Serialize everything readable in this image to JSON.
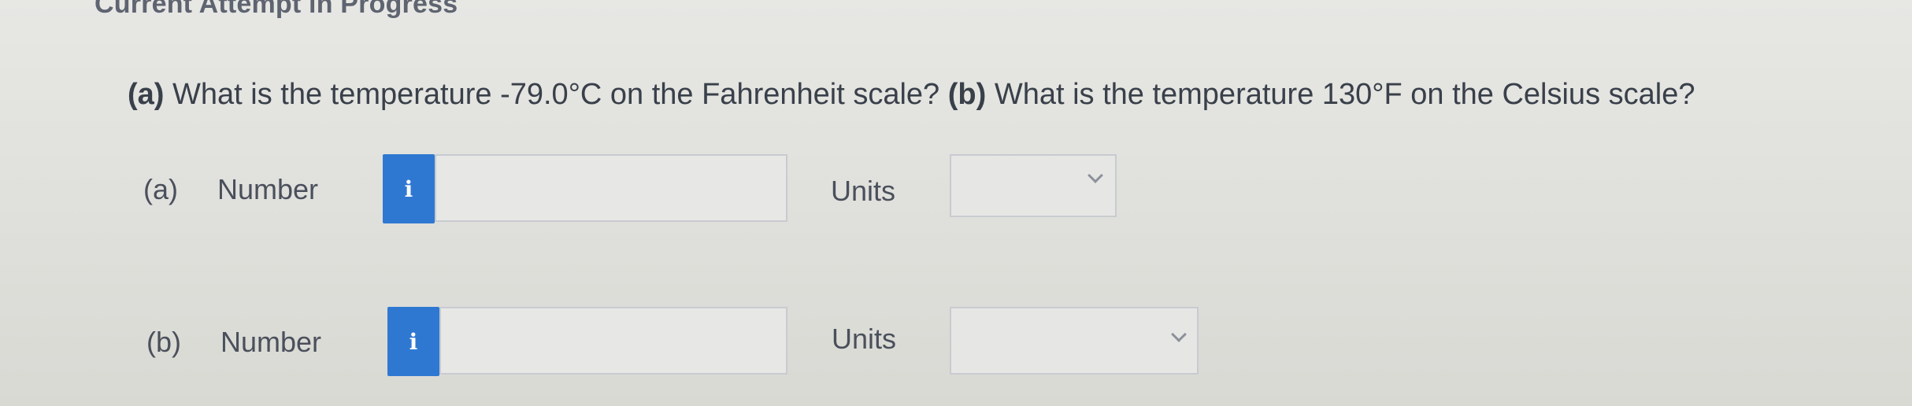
{
  "header": {
    "title": "Current Attempt in Progress"
  },
  "question": {
    "part_a_marker": "(a)",
    "part_a_text": " What is the temperature -79.0°C on the Fahrenheit scale? ",
    "part_b_marker": "(b)",
    "part_b_text": " What is the temperature 130°F on the Celsius scale?"
  },
  "answers": [
    {
      "part_label": "(a)",
      "number_label": "Number",
      "info_icon": "i",
      "input_value": "",
      "units_label": "Units",
      "units_value": ""
    },
    {
      "part_label": "(b)",
      "number_label": "Number",
      "info_icon": "i",
      "input_value": "",
      "units_label": "Units",
      "units_value": ""
    }
  ],
  "colors": {
    "info_button": "#2f78d2",
    "text": "#39404a",
    "border": "#c8cbd0"
  }
}
